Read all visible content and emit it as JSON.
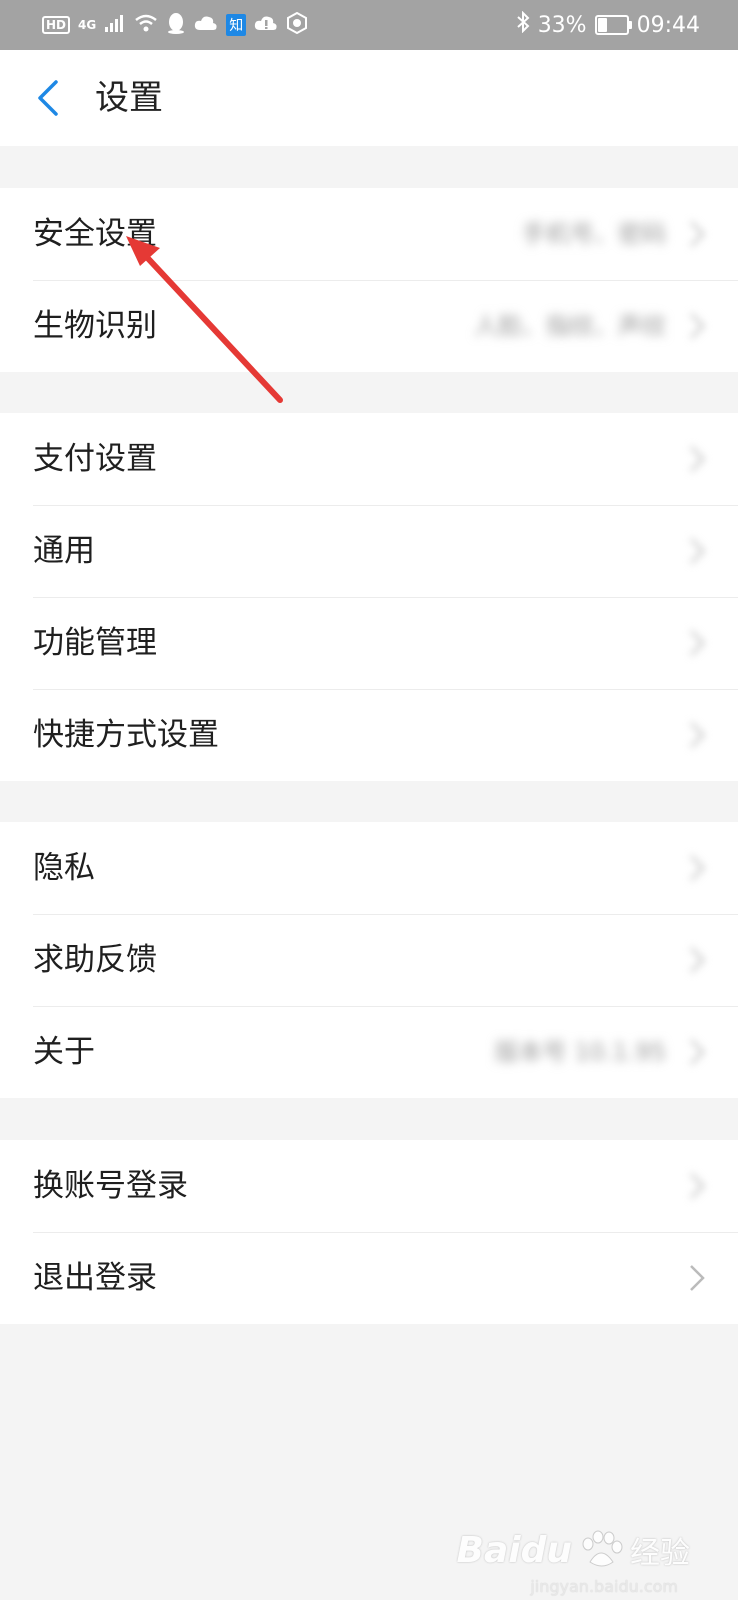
{
  "status_bar": {
    "left_chips": [
      "HD",
      "4G"
    ],
    "zhi_label": "知",
    "battery_percent_text": "33%",
    "battery_level": 0.33,
    "time": "09:44",
    "icons": [
      "signal-icon",
      "wifi-icon",
      "qq-icon",
      "cloud-icon",
      "zhihu-icon",
      "cloud-alert-icon",
      "app-icon",
      "bluetooth-icon",
      "battery-icon"
    ]
  },
  "header": {
    "title": "设置"
  },
  "groups": [
    {
      "rows": [
        {
          "label": "安全设置",
          "value": "手机号、密码"
        },
        {
          "label": "生物识别",
          "value": "人脸、指纹、声纹"
        }
      ]
    },
    {
      "rows": [
        {
          "label": "支付设置",
          "value": ""
        },
        {
          "label": "通用",
          "value": ""
        },
        {
          "label": "功能管理",
          "value": ""
        },
        {
          "label": "快捷方式设置",
          "value": ""
        }
      ]
    },
    {
      "rows": [
        {
          "label": "隐私",
          "value": ""
        },
        {
          "label": "求助反馈",
          "value": ""
        },
        {
          "label": "关于",
          "value": "版本号 10.1.95"
        }
      ]
    },
    {
      "rows": [
        {
          "label": "换账号登录",
          "value": ""
        },
        {
          "label": "退出登录",
          "value": ""
        }
      ]
    }
  ],
  "annotation": {
    "color": "#e53935",
    "points_to": "安全设置"
  },
  "watermark": {
    "logo": "Baidu",
    "text": "经验",
    "url": "jingyan.baidu.com"
  },
  "colors": {
    "accent": "#1e88e5",
    "background": "#f4f4f4",
    "status_bar": "#a3a3a3"
  }
}
